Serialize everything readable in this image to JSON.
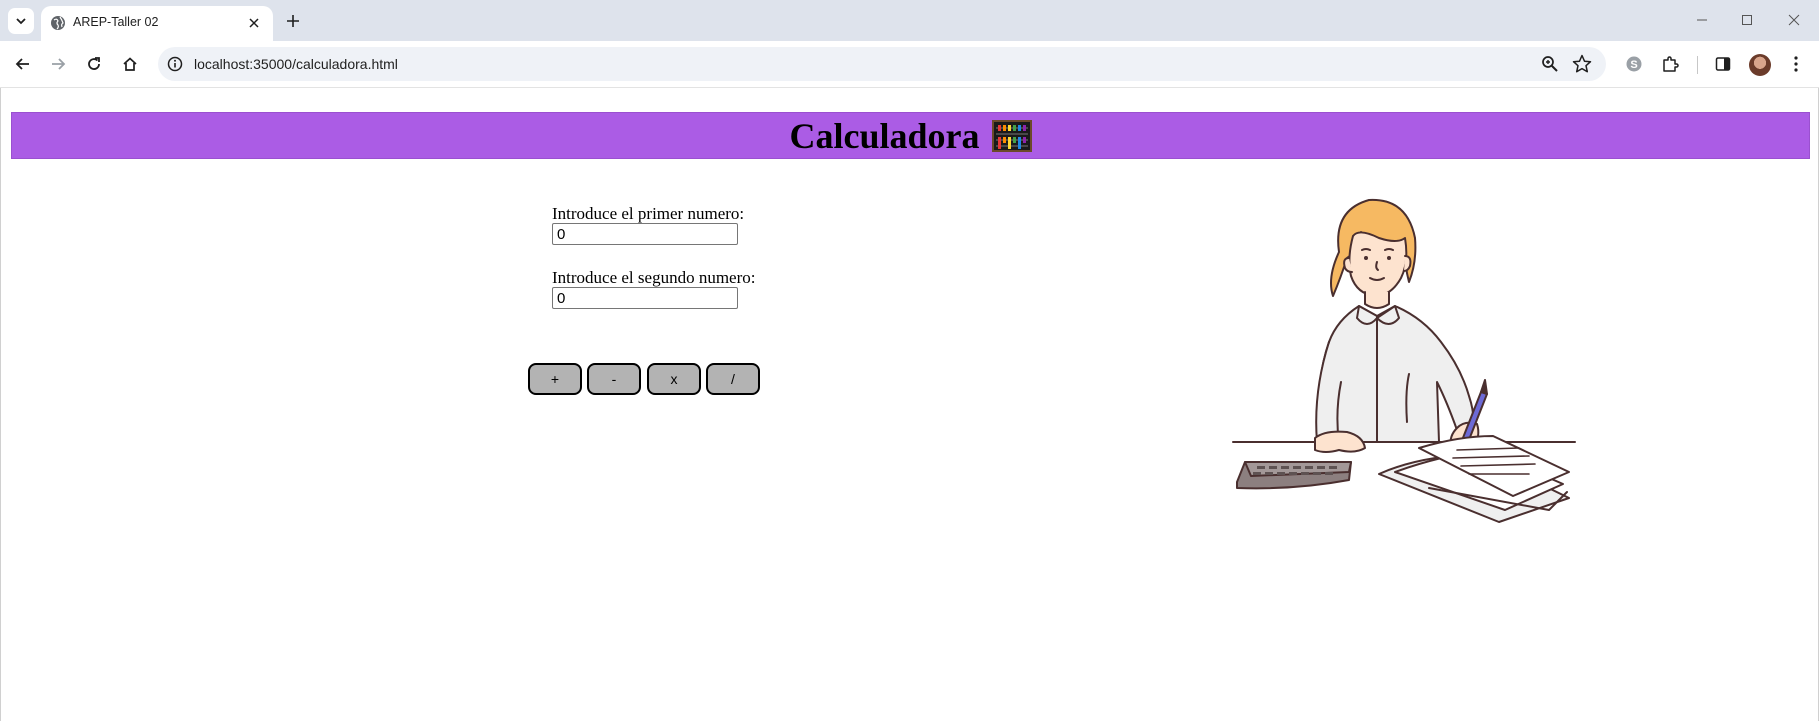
{
  "browser": {
    "tab_title": "AREP-Taller 02",
    "url": "localhost:35000/calculadora.html"
  },
  "page": {
    "heading": "Calculadora",
    "heading_icon": "abacus-icon",
    "first_label": "Introduce el primer numero:",
    "first_value": "0",
    "second_label": "Introduce el segundo numero:",
    "second_value": "0",
    "buttons": {
      "add": "+",
      "subtract": "-",
      "multiply": "x",
      "divide": "/"
    },
    "banner_color": "#ab5ce5",
    "button_color": "#b3b3b3"
  }
}
